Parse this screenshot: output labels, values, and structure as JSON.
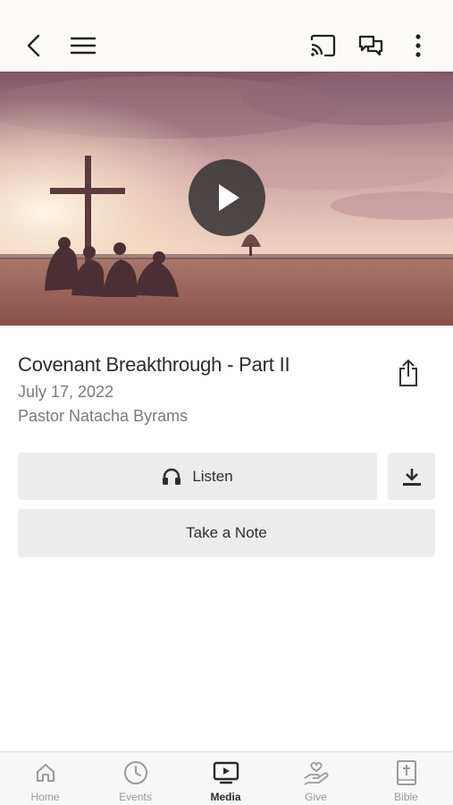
{
  "header": {
    "back_icon": "chevron-left-icon",
    "menu_icon": "hamburger-menu-icon",
    "cast_icon": "cast-icon",
    "chat_icon": "chat-bubbles-icon",
    "more_icon": "more-vertical-icon"
  },
  "media": {
    "title": "Covenant Breakthrough - Part II",
    "date": "July 17, 2022",
    "speaker": "Pastor Natacha Byrams",
    "play_icon": "play-icon",
    "share_icon": "share-icon"
  },
  "actions": {
    "listen_label": "Listen",
    "listen_icon": "headphones-icon",
    "download_icon": "download-icon",
    "note_label": "Take a Note"
  },
  "tabs": [
    {
      "label": "Home",
      "icon": "home-icon",
      "active": false
    },
    {
      "label": "Events",
      "icon": "clock-icon",
      "active": false
    },
    {
      "label": "Media",
      "icon": "tv-play-icon",
      "active": true
    },
    {
      "label": "Give",
      "icon": "hand-heart-icon",
      "active": false
    },
    {
      "label": "Bible",
      "icon": "bible-icon",
      "active": false
    }
  ],
  "colors": {
    "button_bg": "#ececed",
    "active_tab": "#2b2b2b",
    "inactive_tab": "#9a9a9a"
  }
}
